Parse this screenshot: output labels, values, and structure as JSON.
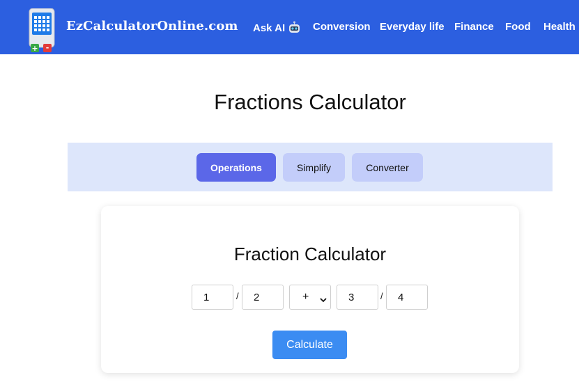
{
  "header": {
    "brand": "EzCalculatorOnline.com",
    "logo_icon": "calculator-logo-icon",
    "nav": [
      {
        "label": "Ask AI",
        "icon": "robot-icon"
      },
      {
        "label": "Conversion"
      },
      {
        "label": "Everyday life"
      },
      {
        "label": "Finance"
      },
      {
        "label": "Food"
      },
      {
        "label": "Health"
      }
    ],
    "colors": {
      "background": "#2c5fe0",
      "text": "#ffffff"
    }
  },
  "page": {
    "title": "Fractions Calculator"
  },
  "tabs": [
    {
      "label": "Operations",
      "active": true
    },
    {
      "label": "Simplify",
      "active": false
    },
    {
      "label": "Converter",
      "active": false
    }
  ],
  "calculator": {
    "title": "Fraction Calculator",
    "fraction1": {
      "numerator": "1",
      "denominator": "2"
    },
    "operator": "+",
    "fraction2": {
      "numerator": "3",
      "denominator": "4"
    },
    "separator": "/",
    "calculate_label": "Calculate"
  },
  "colors": {
    "tab_active": "#5b67e8",
    "tab_inactive": "#c3cdfa",
    "tabs_strip": "#dde6fb",
    "button": "#3b8cf2"
  }
}
